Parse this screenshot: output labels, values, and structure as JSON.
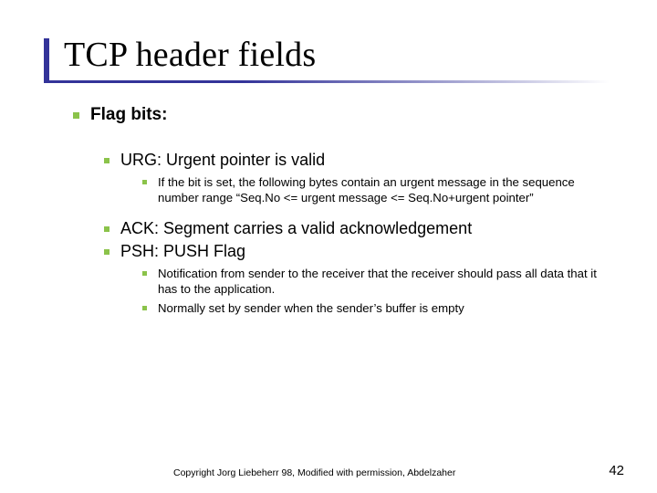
{
  "title": "TCP header fields",
  "flag_bits_label": "Flag bits:",
  "flags": {
    "urg": {
      "label": "URG:",
      "desc": "  Urgent pointer is valid",
      "notes": [
        "If the bit is set, the following bytes contain an urgent message in the sequence number range “Seq.No <= urgent message <= Seq.No+urgent pointer”"
      ]
    },
    "ack": {
      "label": "ACK:",
      "desc": " Segment carries a valid acknowledgement"
    },
    "psh": {
      "label": "PSH:",
      "desc": "  PUSH Flag",
      "notes": [
        "Notification from sender to the receiver that the receiver should pass all data that it has to the application.",
        "Normally set by sender when the sender’s buffer is empty"
      ]
    }
  },
  "footer": {
    "copyright": "Copyright Jorg Liebeherr 98, Modified with permission, Abdelzaher",
    "page": "42"
  },
  "colors": {
    "accent": "#333399",
    "bullet": "#8bc34a"
  }
}
